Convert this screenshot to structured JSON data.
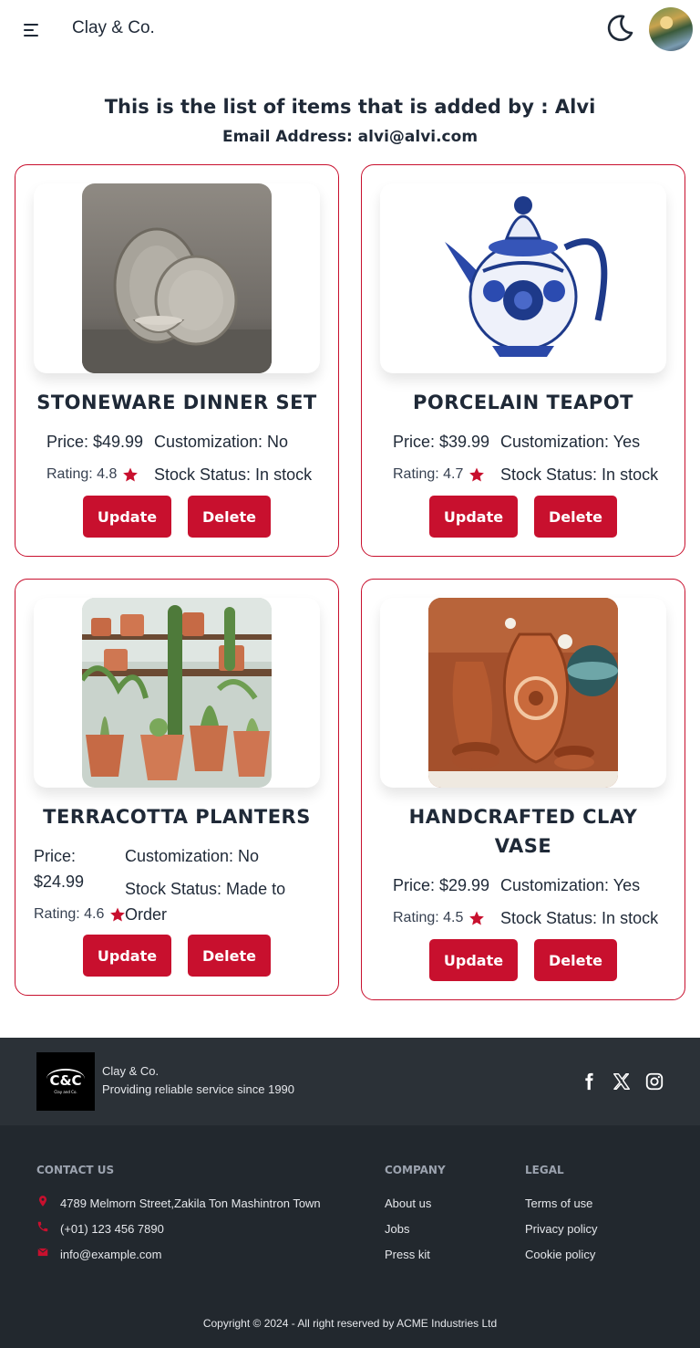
{
  "nav": {
    "brand": "Clay & Co.",
    "menu_icon": "hamburger-menu-icon",
    "theme_icon": "moon-icon",
    "avatar": "user-avatar"
  },
  "header": {
    "title": "This is the list of items that is added by : Alvi",
    "email": "Email Address: alvi@alvi.com"
  },
  "items": [
    {
      "name": "STONEWARE DINNER SET",
      "price": "Price: $49.99",
      "customization": "Customization: No",
      "rating": "Rating: 4.8",
      "stock": "Stock Status: In stock",
      "update": "Update",
      "delete": "Delete"
    },
    {
      "name": "PORCELAIN TEAPOT",
      "price": "Price: $39.99",
      "customization": "Customization: Yes",
      "rating": "Rating: 4.7",
      "stock": "Stock Status: In stock",
      "update": "Update",
      "delete": "Delete"
    },
    {
      "name": "TERRACOTTA PLANTERS",
      "price_label": "Price:",
      "price_value": "$24.99",
      "customization": "Customization: No",
      "rating": "Rating: 4.6",
      "stock_line1": "Stock Status: Made to",
      "stock_line2": "Order",
      "update": "Update",
      "delete": "Delete"
    },
    {
      "name_line1": "HANDCRAFTED CLAY",
      "name_line2": "VASE",
      "price": "Price: $29.99",
      "customization": "Customization: Yes",
      "rating": "Rating: 4.5",
      "stock": "Stock Status: In stock",
      "update": "Update",
      "delete": "Delete"
    }
  ],
  "footer": {
    "logo_text": "C&C",
    "logo_sub": "Clay and Co.",
    "brand": "Clay & Co.",
    "tagline": "Providing reliable service since 1990",
    "social_icons": [
      "facebook-icon",
      "x-icon",
      "instagram-icon"
    ],
    "contact": {
      "heading": "CONTACT US",
      "address": "4789 Melmorn Street,Zakila Ton Mashintron Town",
      "phone": "(+01) 123 456 7890",
      "email": "info@example.com"
    },
    "company": {
      "heading": "COMPANY",
      "links": [
        "About us",
        "Jobs",
        "Press kit"
      ]
    },
    "legal": {
      "heading": "LEGAL",
      "links": [
        "Terms of use",
        "Privacy policy",
        "Cookie policy"
      ]
    },
    "copyright": "Copyright © 2024 - All right reserved by ACME Industries Ltd"
  },
  "colors": {
    "accent": "#c8102e",
    "footer_top": "#2b3137",
    "footer_bottom": "#22282e"
  }
}
